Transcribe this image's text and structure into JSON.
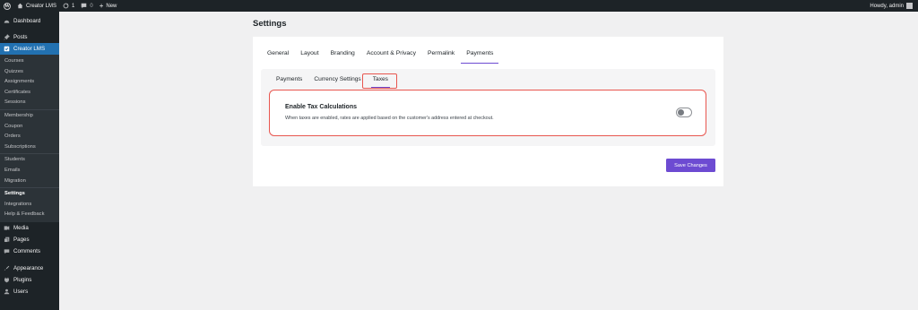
{
  "adminbar": {
    "site_name": "Creator LMS",
    "updates_count": "1",
    "comments_count": "0",
    "new_label": "New",
    "howdy": "Howdy, admin"
  },
  "sidebar": {
    "dashboard": "Dashboard",
    "posts": "Posts",
    "creator_lms": "Creator LMS",
    "group1": [
      "Courses",
      "Quizzes",
      "Assignments",
      "Certificates",
      "Sessions"
    ],
    "group2": [
      "Membership",
      "Coupon",
      "Orders",
      "Subscriptions"
    ],
    "group3": [
      "Students",
      "Emails",
      "Migration"
    ],
    "group4": [
      "Settings",
      "Integrations",
      "Help & Feedback"
    ],
    "media": "Media",
    "pages": "Pages",
    "comments": "Comments",
    "appearance": "Appearance",
    "plugins": "Plugins",
    "users": "Users"
  },
  "page": {
    "title": "Settings",
    "tabs": [
      "General",
      "Layout",
      "Branding",
      "Account & Privacy",
      "Permalink",
      "Payments"
    ],
    "active_tab": "Payments",
    "subtabs": [
      "Payments",
      "Currency Settings",
      "Taxes"
    ],
    "active_subtab": "Taxes",
    "setting": {
      "title": "Enable Tax Calculations",
      "description": "When taxes are enabled, rates are applied based on the customer's address entered at checkout.",
      "enabled": false
    },
    "save_label": "Save Changes"
  },
  "colors": {
    "accent": "#6d4bd2",
    "highlight": "#e8564f",
    "admin_dark": "#1d2327",
    "menu_active": "#2271b1"
  }
}
